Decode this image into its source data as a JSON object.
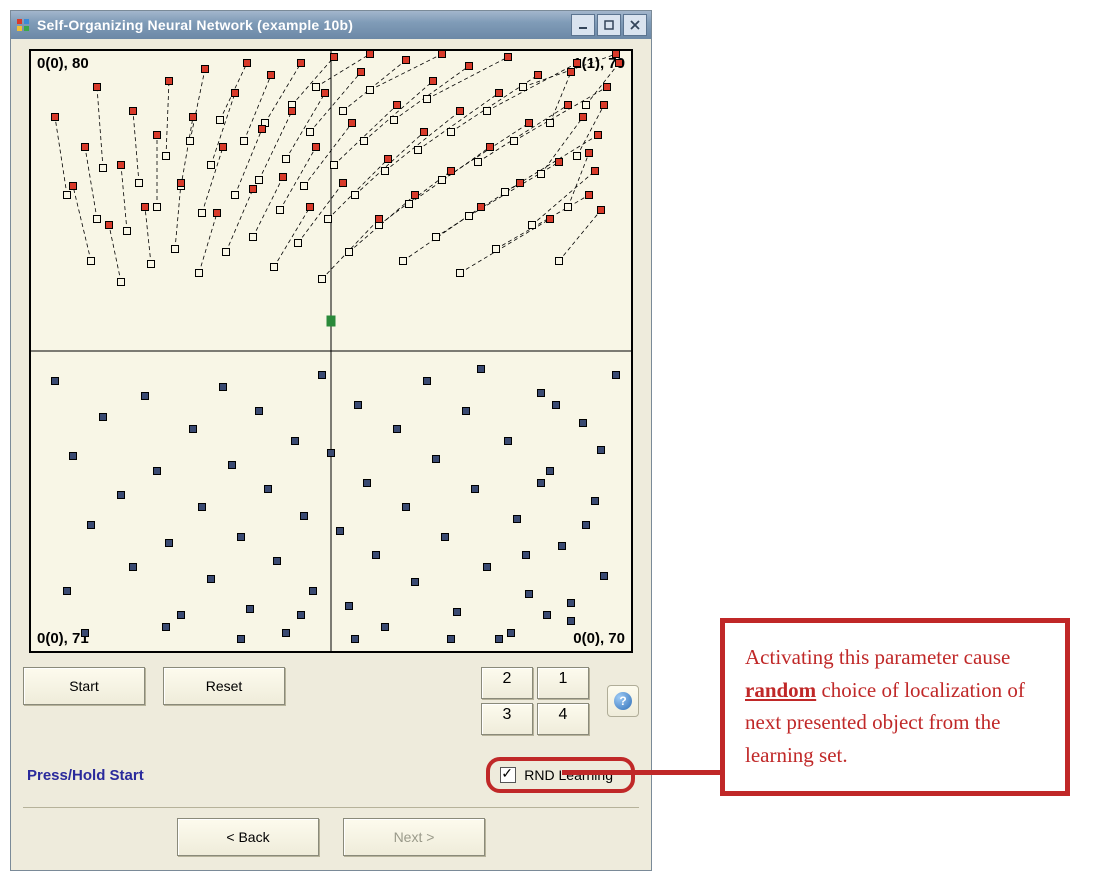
{
  "window": {
    "title": "Self-Organizing Neural Network (example 10b)"
  },
  "chart_data": {
    "type": "scatter",
    "xlim": [
      -1,
      1
    ],
    "ylim": [
      -1,
      1
    ],
    "quadrant_labels": {
      "tl": "0(0), 80",
      "tr": "1(1), 79",
      "bl": "0(0), 71",
      "br": "0(0), 70"
    },
    "series": [
      {
        "name": "initial-neurons",
        "marker": "open-square",
        "color": "#000000",
        "points": [
          [
            -0.88,
            0.52
          ],
          [
            -0.8,
            0.3
          ],
          [
            -0.78,
            0.44
          ],
          [
            -0.76,
            0.61
          ],
          [
            -0.7,
            0.23
          ],
          [
            -0.68,
            0.4
          ],
          [
            -0.64,
            0.56
          ],
          [
            -0.6,
            0.29
          ],
          [
            -0.58,
            0.48
          ],
          [
            -0.55,
            0.65
          ],
          [
            -0.52,
            0.34
          ],
          [
            -0.5,
            0.55
          ],
          [
            -0.47,
            0.7
          ],
          [
            -0.44,
            0.26
          ],
          [
            -0.43,
            0.46
          ],
          [
            -0.4,
            0.62
          ],
          [
            -0.37,
            0.77
          ],
          [
            -0.35,
            0.33
          ],
          [
            -0.32,
            0.52
          ],
          [
            -0.29,
            0.7
          ],
          [
            -0.26,
            0.38
          ],
          [
            -0.24,
            0.57
          ],
          [
            -0.22,
            0.76
          ],
          [
            -0.19,
            0.28
          ],
          [
            -0.17,
            0.47
          ],
          [
            -0.15,
            0.64
          ],
          [
            -0.13,
            0.82
          ],
          [
            -0.11,
            0.36
          ],
          [
            -0.09,
            0.55
          ],
          [
            -0.07,
            0.73
          ],
          [
            -0.05,
            0.88
          ],
          [
            -0.03,
            0.24
          ],
          [
            -0.01,
            0.44
          ],
          [
            0.01,
            0.62
          ],
          [
            0.04,
            0.8
          ],
          [
            0.06,
            0.33
          ],
          [
            0.08,
            0.52
          ],
          [
            0.11,
            0.7
          ],
          [
            0.13,
            0.87
          ],
          [
            0.16,
            0.42
          ],
          [
            0.18,
            0.6
          ],
          [
            0.21,
            0.77
          ],
          [
            0.24,
            0.3
          ],
          [
            0.26,
            0.49
          ],
          [
            0.29,
            0.67
          ],
          [
            0.32,
            0.84
          ],
          [
            0.35,
            0.38
          ],
          [
            0.37,
            0.57
          ],
          [
            0.4,
            0.73
          ],
          [
            0.43,
            0.26
          ],
          [
            0.46,
            0.45
          ],
          [
            0.49,
            0.63
          ],
          [
            0.52,
            0.8
          ],
          [
            0.55,
            0.34
          ],
          [
            0.58,
            0.53
          ],
          [
            0.61,
            0.7
          ],
          [
            0.64,
            0.88
          ],
          [
            0.67,
            0.42
          ],
          [
            0.7,
            0.59
          ],
          [
            0.73,
            0.76
          ],
          [
            0.76,
            0.3
          ],
          [
            0.79,
            0.48
          ],
          [
            0.82,
            0.65
          ],
          [
            0.85,
            0.82
          ]
        ]
      },
      {
        "name": "moved-neurons",
        "marker": "filled-square",
        "color": "#d83a2a",
        "points": [
          [
            -0.92,
            0.78
          ],
          [
            -0.86,
            0.55
          ],
          [
            -0.82,
            0.68
          ],
          [
            -0.78,
            0.88
          ],
          [
            -0.74,
            0.42
          ],
          [
            -0.7,
            0.62
          ],
          [
            -0.66,
            0.8
          ],
          [
            -0.62,
            0.48
          ],
          [
            -0.58,
            0.72
          ],
          [
            -0.54,
            0.9
          ],
          [
            -0.5,
            0.56
          ],
          [
            -0.46,
            0.78
          ],
          [
            -0.42,
            0.94
          ],
          [
            -0.38,
            0.46
          ],
          [
            -0.36,
            0.68
          ],
          [
            -0.32,
            0.86
          ],
          [
            -0.28,
            0.96
          ],
          [
            -0.26,
            0.54
          ],
          [
            -0.23,
            0.74
          ],
          [
            -0.2,
            0.92
          ],
          [
            -0.16,
            0.58
          ],
          [
            -0.13,
            0.8
          ],
          [
            -0.1,
            0.96
          ],
          [
            -0.07,
            0.48
          ],
          [
            -0.05,
            0.68
          ],
          [
            -0.02,
            0.86
          ],
          [
            0.01,
            0.98
          ],
          [
            0.04,
            0.56
          ],
          [
            0.07,
            0.76
          ],
          [
            0.1,
            0.93
          ],
          [
            0.13,
            0.99
          ],
          [
            0.16,
            0.44
          ],
          [
            0.19,
            0.64
          ],
          [
            0.22,
            0.82
          ],
          [
            0.25,
            0.97
          ],
          [
            0.28,
            0.52
          ],
          [
            0.31,
            0.73
          ],
          [
            0.34,
            0.9
          ],
          [
            0.37,
            0.99
          ],
          [
            0.4,
            0.6
          ],
          [
            0.43,
            0.8
          ],
          [
            0.46,
            0.95
          ],
          [
            0.5,
            0.48
          ],
          [
            0.53,
            0.68
          ],
          [
            0.56,
            0.86
          ],
          [
            0.59,
            0.98
          ],
          [
            0.63,
            0.56
          ],
          [
            0.66,
            0.76
          ],
          [
            0.69,
            0.92
          ],
          [
            0.73,
            0.44
          ],
          [
            0.76,
            0.63
          ],
          [
            0.79,
            0.82
          ],
          [
            0.82,
            0.96
          ],
          [
            0.86,
            0.52
          ],
          [
            0.89,
            0.72
          ],
          [
            0.92,
            0.88
          ],
          [
            0.95,
            0.99
          ],
          [
            0.88,
            0.6
          ],
          [
            0.84,
            0.78
          ],
          [
            0.8,
            0.93
          ],
          [
            0.9,
            0.47
          ],
          [
            0.86,
            0.66
          ],
          [
            0.91,
            0.82
          ],
          [
            0.96,
            0.96
          ]
        ]
      },
      {
        "name": "lower-data",
        "marker": "filled-square",
        "color": "#3a4a72",
        "points": [
          [
            -0.92,
            -0.1
          ],
          [
            -0.86,
            -0.35
          ],
          [
            -0.8,
            -0.58
          ],
          [
            -0.76,
            -0.22
          ],
          [
            -0.7,
            -0.48
          ],
          [
            -0.66,
            -0.72
          ],
          [
            -0.62,
            -0.15
          ],
          [
            -0.58,
            -0.4
          ],
          [
            -0.54,
            -0.64
          ],
          [
            -0.5,
            -0.88
          ],
          [
            -0.46,
            -0.26
          ],
          [
            -0.43,
            -0.52
          ],
          [
            -0.4,
            -0.76
          ],
          [
            -0.36,
            -0.12
          ],
          [
            -0.33,
            -0.38
          ],
          [
            -0.3,
            -0.62
          ],
          [
            -0.27,
            -0.86
          ],
          [
            -0.24,
            -0.2
          ],
          [
            -0.21,
            -0.46
          ],
          [
            -0.18,
            -0.7
          ],
          [
            -0.15,
            -0.94
          ],
          [
            -0.12,
            -0.3
          ],
          [
            -0.09,
            -0.55
          ],
          [
            -0.06,
            -0.8
          ],
          [
            -0.03,
            -0.08
          ],
          [
            0.0,
            -0.34
          ],
          [
            0.03,
            -0.6
          ],
          [
            0.06,
            -0.85
          ],
          [
            0.09,
            -0.18
          ],
          [
            0.12,
            -0.44
          ],
          [
            0.15,
            -0.68
          ],
          [
            0.18,
            -0.92
          ],
          [
            0.22,
            -0.26
          ],
          [
            0.25,
            -0.52
          ],
          [
            0.28,
            -0.77
          ],
          [
            0.32,
            -0.1
          ],
          [
            0.35,
            -0.36
          ],
          [
            0.38,
            -0.62
          ],
          [
            0.42,
            -0.87
          ],
          [
            0.45,
            -0.2
          ],
          [
            0.48,
            -0.46
          ],
          [
            0.52,
            -0.72
          ],
          [
            0.56,
            -0.96
          ],
          [
            0.59,
            -0.3
          ],
          [
            0.62,
            -0.56
          ],
          [
            0.66,
            -0.81
          ],
          [
            0.7,
            -0.14
          ],
          [
            0.73,
            -0.4
          ],
          [
            0.77,
            -0.65
          ],
          [
            0.8,
            -0.9
          ],
          [
            0.84,
            -0.24
          ],
          [
            0.88,
            -0.5
          ],
          [
            0.91,
            -0.75
          ],
          [
            0.95,
            -0.08
          ],
          [
            0.9,
            -0.33
          ],
          [
            0.85,
            -0.58
          ],
          [
            0.8,
            -0.84
          ],
          [
            0.75,
            -0.18
          ],
          [
            0.7,
            -0.44
          ],
          [
            0.65,
            -0.68
          ],
          [
            0.6,
            -0.94
          ],
          [
            -0.88,
            -0.8
          ],
          [
            -0.82,
            -0.94
          ],
          [
            -0.55,
            -0.92
          ],
          [
            -0.1,
            -0.88
          ],
          [
            0.4,
            -0.96
          ],
          [
            0.08,
            -0.96
          ],
          [
            -0.3,
            -0.96
          ],
          [
            0.72,
            -0.88
          ],
          [
            0.5,
            -0.06
          ]
        ]
      }
    ],
    "displacement_lines": {
      "from_series": "initial-neurons",
      "to_series": "moved-neurons",
      "style": "dashed"
    },
    "center_marker": {
      "x": 0.0,
      "y": 0.1,
      "color": "#2a8a3a"
    }
  },
  "controls": {
    "start": "Start",
    "reset": "Reset",
    "num_buttons": [
      "2",
      "1",
      "3",
      "4"
    ],
    "help_tooltip": "?"
  },
  "checkbox": {
    "label": "RND Learning",
    "checked": true
  },
  "status": {
    "label": "Press/Hold Start"
  },
  "nav": {
    "back": "< Back",
    "next": "Next >"
  },
  "callout": {
    "pre": "Activating this parameter cause ",
    "emph": "random",
    "post": " choice of localization of next presented  object  from the learning set."
  }
}
